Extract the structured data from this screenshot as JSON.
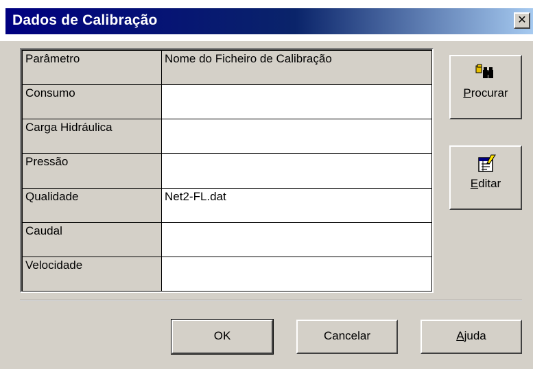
{
  "window": {
    "title": "Dados de Calibração",
    "close_glyph": "✕"
  },
  "grid": {
    "headers": {
      "param": "Parâmetro",
      "file": "Nome do Ficheiro de Calibração"
    },
    "rows": [
      {
        "param": "Consumo",
        "file": ""
      },
      {
        "param": "Carga Hidráulica",
        "file": ""
      },
      {
        "param": "Pressão",
        "file": ""
      },
      {
        "param": "Qualidade",
        "file": "Net2-FL.dat"
      },
      {
        "param": "Caudal",
        "file": ""
      },
      {
        "param": "Velocidade",
        "file": ""
      }
    ]
  },
  "side_buttons": {
    "browse": {
      "label_rest": "rocurar",
      "label_key": "P",
      "icon": "binoculars-icon"
    },
    "edit": {
      "label_rest": "ditar",
      "label_key": "E",
      "icon": "edit-notebook-icon"
    }
  },
  "buttons": {
    "ok": "OK",
    "cancel": "Cancelar",
    "help_key": "A",
    "help_rest": "juda"
  },
  "colors": {
    "titlebar_start": "#000080",
    "titlebar_end": "#a6caf0",
    "face": "#d4d0c8"
  }
}
